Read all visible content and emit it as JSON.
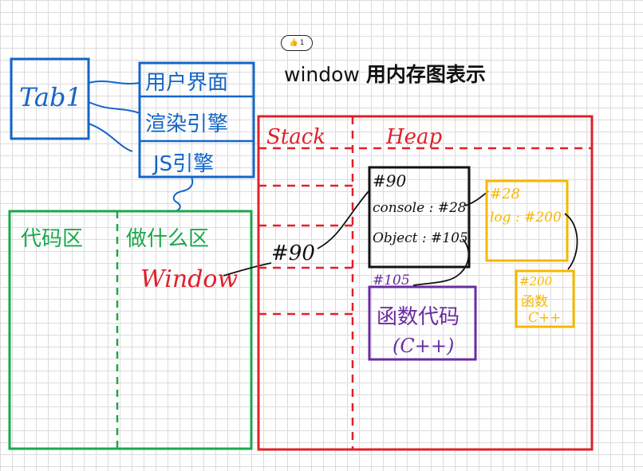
{
  "like": {
    "count": "1",
    "icon": "thumbs-up-icon"
  },
  "title": {
    "prefix": "window",
    "suffix": "用内存图表示"
  },
  "tab": {
    "label": "Tab1"
  },
  "modules": [
    "用户界面",
    "渲染引擎",
    "JS引擎"
  ],
  "code_area": {
    "left": "代码区",
    "right": "做什么区",
    "window": "Window"
  },
  "stack": {
    "label": "Stack",
    "value": "#90"
  },
  "heap": {
    "label": "Heap",
    "window_obj": {
      "addr": "#90",
      "console": "console : #28",
      "object": "Object : #105"
    },
    "console_obj": {
      "addr": "#28",
      "log": "log : #200"
    },
    "func_obj": {
      "addr": "#105",
      "line1": "函数代码",
      "line2": "(C++)"
    },
    "log_obj": {
      "addr": "#200",
      "line1": "函数",
      "line2": "C++"
    }
  },
  "colors": {
    "blue": "#1565c8",
    "green": "#1aa84a",
    "red": "#e0202a",
    "black": "#111111",
    "yellow": "#f5b800",
    "purple": "#6a2ca0"
  }
}
